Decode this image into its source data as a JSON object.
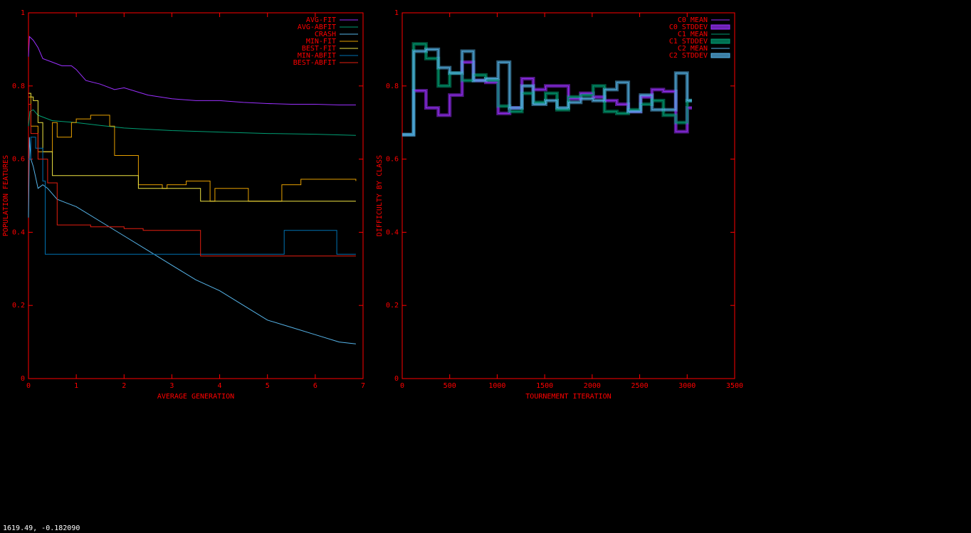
{
  "status_readout": "1619.49, -0.182090",
  "colors": {
    "axes": "#ff0000",
    "background": "#000000",
    "readout": "#ffffff"
  },
  "chart_data": [
    {
      "type": "line",
      "xlabel": "AVERAGE GENERATION",
      "ylabel": "POPULATION FEATURES",
      "xlim": [
        0,
        7
      ],
      "ylim": [
        0,
        1
      ],
      "xticks": [
        0,
        1,
        2,
        3,
        4,
        5,
        6,
        7
      ],
      "yticks": [
        0,
        0.2,
        0.4,
        0.6,
        0.8,
        1
      ],
      "legend_position": "top-right",
      "series": [
        {
          "name": "AVG-FIT",
          "color": "#9b30ff",
          "style": "line",
          "x": [
            0,
            0.02,
            0.1,
            0.2,
            0.3,
            0.5,
            0.7,
            0.9,
            1.0,
            1.2,
            1.5,
            1.8,
            2.0,
            2.5,
            3.0,
            3.5,
            4.0,
            4.5,
            5.0,
            5.5,
            6.0,
            6.5,
            6.85
          ],
          "y": [
            0.88,
            0.935,
            0.925,
            0.905,
            0.875,
            0.865,
            0.855,
            0.855,
            0.845,
            0.815,
            0.805,
            0.79,
            0.795,
            0.775,
            0.765,
            0.76,
            0.76,
            0.755,
            0.752,
            0.75,
            0.75,
            0.748,
            0.748
          ]
        },
        {
          "name": "AVG-ABFIT",
          "color": "#009e73",
          "style": "line",
          "x": [
            0,
            0.03,
            0.1,
            0.2,
            0.5,
            1.0,
            1.5,
            2.0,
            3.0,
            4.0,
            5.0,
            6.0,
            6.85
          ],
          "y": [
            0.69,
            0.73,
            0.735,
            0.72,
            0.705,
            0.7,
            0.692,
            0.685,
            0.678,
            0.674,
            0.67,
            0.668,
            0.665
          ]
        },
        {
          "name": "CRASH",
          "color": "#56b4e9",
          "style": "line",
          "x": [
            0,
            0.02,
            0.05,
            0.1,
            0.15,
            0.2,
            0.3,
            0.4,
            0.6,
            0.8,
            1.0,
            1.5,
            2.0,
            2.5,
            3.0,
            3.5,
            4.0,
            4.5,
            5.0,
            5.5,
            6.0,
            6.5,
            6.85
          ],
          "y": [
            0.44,
            0.66,
            0.6,
            0.58,
            0.55,
            0.52,
            0.53,
            0.52,
            0.49,
            0.48,
            0.47,
            0.43,
            0.39,
            0.35,
            0.31,
            0.27,
            0.24,
            0.2,
            0.16,
            0.14,
            0.12,
            0.1,
            0.095
          ]
        },
        {
          "name": "MIN-FIT",
          "color": "#e69f00",
          "style": "step",
          "x": [
            0,
            0.05,
            0.2,
            0.5,
            0.6,
            0.9,
            1.0,
            1.3,
            1.7,
            1.8,
            2.3,
            2.8,
            2.9,
            3.3,
            3.8,
            3.9,
            4.6,
            5.3,
            5.7,
            6.85
          ],
          "y": [
            0.77,
            0.69,
            0.62,
            0.7,
            0.66,
            0.7,
            0.71,
            0.72,
            0.69,
            0.61,
            0.53,
            0.52,
            0.53,
            0.54,
            0.485,
            0.52,
            0.485,
            0.53,
            0.545,
            0.54
          ]
        },
        {
          "name": "BEST-FIT",
          "color": "#f0e442",
          "style": "step",
          "x": [
            0,
            0.05,
            0.1,
            0.2,
            0.3,
            0.5,
            1.5,
            2.3,
            2.5,
            3.0,
            3.6,
            4.0,
            5.0,
            6.0,
            6.85
          ],
          "y": [
            0.78,
            0.77,
            0.76,
            0.7,
            0.62,
            0.555,
            0.555,
            0.52,
            0.52,
            0.52,
            0.485,
            0.485,
            0.485,
            0.485,
            0.485
          ]
        },
        {
          "name": "MIN-ABFIT",
          "color": "#0072b2",
          "style": "step",
          "x": [
            0,
            0.05,
            0.15,
            0.3,
            0.35,
            1.0,
            2.0,
            3.0,
            3.6,
            4.0,
            5.0,
            5.35,
            6.0,
            6.45,
            6.85
          ],
          "y": [
            0.6,
            0.66,
            0.63,
            0.54,
            0.34,
            0.34,
            0.34,
            0.34,
            0.34,
            0.34,
            0.34,
            0.405,
            0.405,
            0.34,
            0.34
          ]
        },
        {
          "name": "BEST-ABFIT",
          "color": "#e51e10",
          "style": "step",
          "x": [
            0,
            0.05,
            0.2,
            0.4,
            0.6,
            1.3,
            2.0,
            2.4,
            3.0,
            3.6,
            4.5,
            5.5,
            6.85
          ],
          "y": [
            0.75,
            0.67,
            0.6,
            0.535,
            0.42,
            0.415,
            0.41,
            0.405,
            0.405,
            0.335,
            0.335,
            0.335,
            0.335
          ]
        }
      ]
    },
    {
      "type": "line",
      "xlabel": "TOURNEMENT ITERATION",
      "ylabel": "DIFFICULTY BY CLASS",
      "xlim": [
        0,
        3500
      ],
      "ylim": [
        0,
        1
      ],
      "xticks": [
        0,
        500,
        1000,
        1500,
        2000,
        2500,
        3000,
        3500
      ],
      "yticks": [
        0,
        0.2,
        0.4,
        0.6,
        0.8,
        1
      ],
      "legend_position": "top-right",
      "series": [
        {
          "name": "C0 MEAN",
          "color": "#9b30ff",
          "style": "step",
          "x": [
            0,
            120,
            250,
            380,
            500,
            630,
            750,
            880,
            1010,
            1130,
            1260,
            1380,
            1510,
            1630,
            1750,
            1880,
            2010,
            2130,
            2260,
            2380,
            2510,
            2630,
            2750,
            2880,
            3000,
            3050
          ],
          "y": [
            0.667,
            0.787,
            0.74,
            0.72,
            0.775,
            0.865,
            0.815,
            0.81,
            0.725,
            0.74,
            0.82,
            0.79,
            0.8,
            0.8,
            0.765,
            0.78,
            0.77,
            0.76,
            0.75,
            0.73,
            0.77,
            0.79,
            0.785,
            0.675,
            0.74,
            0.74
          ]
        },
        {
          "name": "C0 STDDEV",
          "color": "#9b30ff",
          "style": "band"
        },
        {
          "name": "C1 MEAN",
          "color": "#009e73",
          "style": "step",
          "x": [
            0,
            120,
            250,
            380,
            500,
            630,
            750,
            880,
            1010,
            1130,
            1260,
            1380,
            1510,
            1630,
            1750,
            1880,
            2010,
            2130,
            2260,
            2380,
            2510,
            2630,
            2750,
            2880,
            3000,
            3050
          ],
          "y": [
            0.667,
            0.915,
            0.875,
            0.8,
            0.835,
            0.815,
            0.83,
            0.815,
            0.745,
            0.73,
            0.78,
            0.755,
            0.78,
            0.735,
            0.77,
            0.775,
            0.8,
            0.73,
            0.725,
            0.735,
            0.75,
            0.76,
            0.72,
            0.7,
            0.76,
            0.76
          ]
        },
        {
          "name": "C1 STDDEV",
          "color": "#009e73",
          "style": "band"
        },
        {
          "name": "C2 MEAN",
          "color": "#56b4e9",
          "style": "step",
          "x": [
            0,
            120,
            250,
            380,
            500,
            630,
            750,
            880,
            1010,
            1130,
            1260,
            1380,
            1510,
            1630,
            1750,
            1880,
            2010,
            2130,
            2260,
            2380,
            2510,
            2630,
            2750,
            2880,
            3000,
            3050
          ],
          "y": [
            0.667,
            0.895,
            0.9,
            0.85,
            0.835,
            0.895,
            0.815,
            0.82,
            0.865,
            0.74,
            0.8,
            0.75,
            0.76,
            0.74,
            0.755,
            0.765,
            0.76,
            0.79,
            0.81,
            0.73,
            0.775,
            0.735,
            0.735,
            0.835,
            0.76,
            0.76
          ]
        },
        {
          "name": "C2 STDDEV",
          "color": "#56b4e9",
          "style": "band"
        }
      ]
    }
  ]
}
